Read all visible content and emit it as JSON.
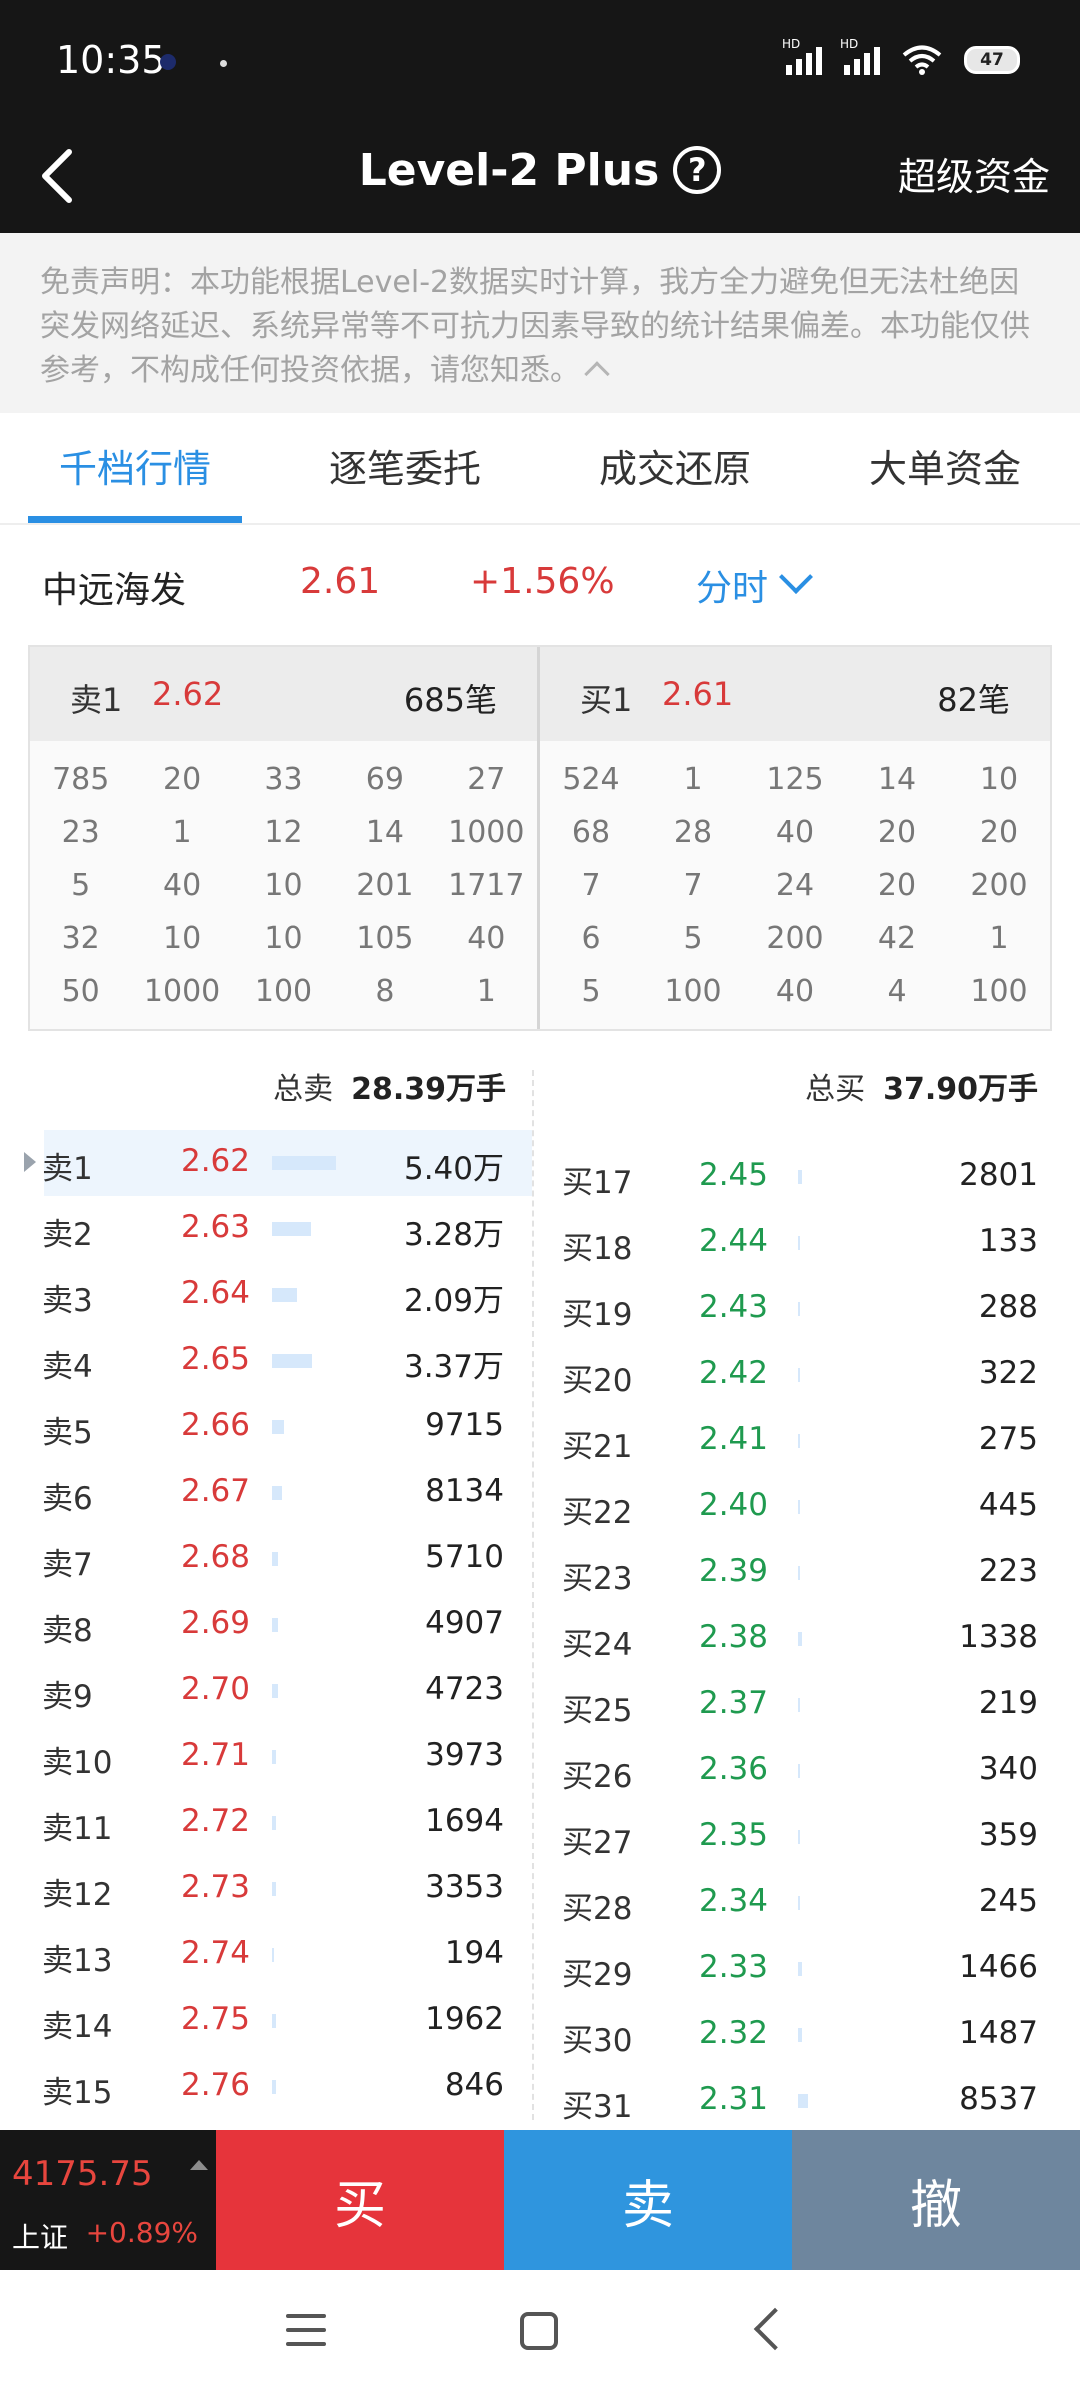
{
  "status": {
    "time": "10:35",
    "battery": "47",
    "network1": "HD",
    "network2": "HD"
  },
  "header": {
    "title": "Level-2 Plus",
    "help": "?",
    "right_link": "超级资金"
  },
  "disclaimer": "免责声明：本功能根据Level-2数据实时计算，我方全力避免但无法杜绝因突发网络延迟、系统异常等不可抗力因素导致的统计结果偏差。本功能仅供参考，不构成任何投资依据，请您知悉。",
  "tabs": [
    {
      "label": "千档行情",
      "active": true
    },
    {
      "label": "逐笔委托"
    },
    {
      "label": "成交还原"
    },
    {
      "label": "大单资金"
    }
  ],
  "stock": {
    "name": "中远海发",
    "price": "2.61",
    "change": "+1.56%",
    "period": "分时"
  },
  "queue": {
    "sell": {
      "label": "卖1",
      "price": "2.62",
      "count": "685笔",
      "values": [
        "785",
        "20",
        "33",
        "69",
        "27",
        "23",
        "1",
        "12",
        "14",
        "1000",
        "5",
        "40",
        "10",
        "201",
        "1717",
        "32",
        "10",
        "10",
        "105",
        "40",
        "50",
        "1000",
        "100",
        "8",
        "1"
      ]
    },
    "buy": {
      "label": "买1",
      "price": "2.61",
      "count": "82笔",
      "values": [
        "524",
        "1",
        "125",
        "14",
        "10",
        "68",
        "28",
        "40",
        "20",
        "20",
        "7",
        "7",
        "24",
        "20",
        "200",
        "6",
        "5",
        "200",
        "42",
        "1",
        "5",
        "100",
        "40",
        "4",
        "100"
      ]
    }
  },
  "book": {
    "sell_total_label": "总卖",
    "sell_total": "28.39万手",
    "buy_total_label": "总买",
    "buy_total": "37.90万手",
    "sell": [
      {
        "label": "卖1",
        "price": "2.62",
        "volume": "5.40万",
        "ratio": 1.0
      },
      {
        "label": "卖2",
        "price": "2.63",
        "volume": "3.28万",
        "ratio": 0.61
      },
      {
        "label": "卖3",
        "price": "2.64",
        "volume": "2.09万",
        "ratio": 0.39
      },
      {
        "label": "卖4",
        "price": "2.65",
        "volume": "3.37万",
        "ratio": 0.62
      },
      {
        "label": "卖5",
        "price": "2.66",
        "volume": "9715",
        "ratio": 0.18
      },
      {
        "label": "卖6",
        "price": "2.67",
        "volume": "8134",
        "ratio": 0.15
      },
      {
        "label": "卖7",
        "price": "2.68",
        "volume": "5710",
        "ratio": 0.1
      },
      {
        "label": "卖8",
        "price": "2.69",
        "volume": "4907",
        "ratio": 0.09
      },
      {
        "label": "卖9",
        "price": "2.70",
        "volume": "4723",
        "ratio": 0.09
      },
      {
        "label": "卖10",
        "price": "2.71",
        "volume": "3973",
        "ratio": 0.07
      },
      {
        "label": "卖11",
        "price": "2.72",
        "volume": "1694",
        "ratio": 0.03
      },
      {
        "label": "卖12",
        "price": "2.73",
        "volume": "3353",
        "ratio": 0.06
      },
      {
        "label": "卖13",
        "price": "2.74",
        "volume": "194",
        "ratio": 0.0
      },
      {
        "label": "卖14",
        "price": "2.75",
        "volume": "1962",
        "ratio": 0.03
      },
      {
        "label": "卖15",
        "price": "2.76",
        "volume": "846",
        "ratio": 0.02
      }
    ],
    "buy": [
      {
        "label": "买17",
        "price": "2.45",
        "volume": "2801",
        "ratio": 0.05
      },
      {
        "label": "买18",
        "price": "2.44",
        "volume": "133",
        "ratio": 0.0
      },
      {
        "label": "买19",
        "price": "2.43",
        "volume": "288",
        "ratio": 0.0
      },
      {
        "label": "买20",
        "price": "2.42",
        "volume": "322",
        "ratio": 0.0
      },
      {
        "label": "买21",
        "price": "2.41",
        "volume": "275",
        "ratio": 0.0
      },
      {
        "label": "买22",
        "price": "2.40",
        "volume": "445",
        "ratio": 0.0
      },
      {
        "label": "买23",
        "price": "2.39",
        "volume": "223",
        "ratio": 0.0
      },
      {
        "label": "买24",
        "price": "2.38",
        "volume": "1338",
        "ratio": 0.02
      },
      {
        "label": "买25",
        "price": "2.37",
        "volume": "219",
        "ratio": 0.0
      },
      {
        "label": "买26",
        "price": "2.36",
        "volume": "340",
        "ratio": 0.0
      },
      {
        "label": "买27",
        "price": "2.35",
        "volume": "359",
        "ratio": 0.0
      },
      {
        "label": "买28",
        "price": "2.34",
        "volume": "245",
        "ratio": 0.0
      },
      {
        "label": "买29",
        "price": "2.33",
        "volume": "1466",
        "ratio": 0.02
      },
      {
        "label": "买30",
        "price": "2.32",
        "volume": "1487",
        "ratio": 0.02
      },
      {
        "label": "买31",
        "price": "2.31",
        "volume": "8537",
        "ratio": 0.15
      }
    ]
  },
  "index": {
    "value": "4175.75",
    "name": "上证",
    "change": "+0.89%"
  },
  "trade": {
    "buy": "买",
    "sell": "卖",
    "cancel": "撤"
  },
  "colors": {
    "up": "#d83a3a",
    "down": "#1f9a4f",
    "accent": "#2a8fe3",
    "buy_btn": "#e6343b",
    "sell_btn": "#2f95de",
    "cancel_btn": "#6e869e"
  }
}
